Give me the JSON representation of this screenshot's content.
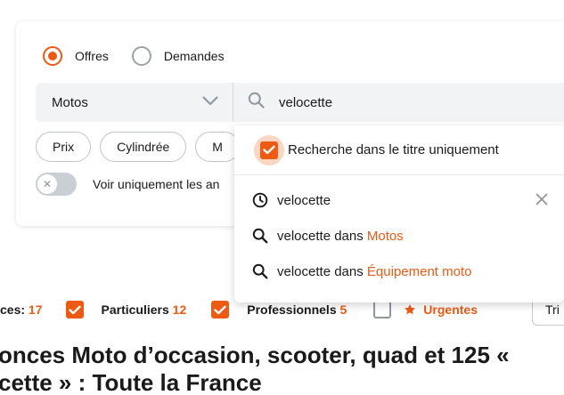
{
  "ad_type": {
    "options": [
      {
        "label": "Offres",
        "selected": true
      },
      {
        "label": "Demandes",
        "selected": false
      }
    ]
  },
  "search": {
    "category": "Motos",
    "query": "velocette"
  },
  "filters": {
    "chips": [
      "Prix",
      "Cylindrée",
      "M"
    ],
    "toggle_label": "Voir uniquement les an",
    "toggle_on": false
  },
  "suggestions": {
    "title_only_label": "Recherche dans le titre uniquement",
    "title_only_checked": true,
    "history": "velocette",
    "items": [
      {
        "query": "velocette",
        "connector": "dans",
        "category": "Motos"
      },
      {
        "query": "velocette",
        "connector": "dans",
        "category": "Équipement moto"
      }
    ]
  },
  "sellers": {
    "partial_label": "ces:",
    "partial_count": "17",
    "particuliers_label": "Particuliers",
    "particuliers_count": "12",
    "pros_label": "Professionnels",
    "pros_count": "5",
    "urgent_label": "Urgentes",
    "sort_label": "Tri"
  },
  "headline": {
    "line1": "onces Moto d’occasion, scooter, quad et 125 «",
    "line2": "cette » : Toute la France"
  },
  "colors": {
    "accent": "#ec5a13",
    "accent_halo": "#fbd6c2",
    "field_bg": "#f1f3f5"
  }
}
